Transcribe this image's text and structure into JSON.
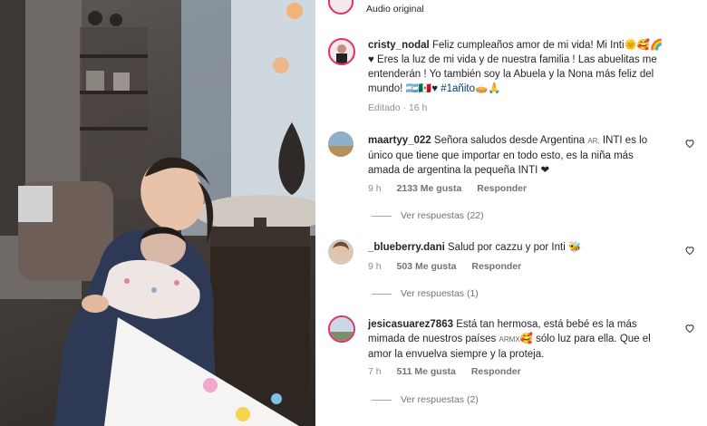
{
  "top": {
    "audio_label": "Audio original"
  },
  "post": {
    "username": "cristy_nodal",
    "caption_lines": [
      "Feliz cumpleaños amor de mi vida! Mi Inti🌞🥰🌈",
      "♥ Eres la luz de mi vida y de nuestra familia ! Las abuelitas me",
      "entenderán ! Yo también soy la Abuela y la Nona más feliz del",
      "mundo! 🇦🇷🇲🇽♥"
    ],
    "hashtag": "#1añito",
    "hashtag_emoji": "🥧🙏",
    "edited": "Editado · 16 h"
  },
  "comments": [
    {
      "username": "maartyy_022",
      "lines": [
        "Señora saludos desde Argentina",
        "INTI es lo",
        "único que tiene que importar en todo esto, es la niña más",
        "amada de argentina la pequeña INTI ❤"
      ],
      "flag_text": "AR,",
      "time": "9 h",
      "likes": "2133 Me gusta",
      "reply": "Responder",
      "replies": "Ver respuestas (22)"
    },
    {
      "username": "_blueberry.dani",
      "lines": [
        "Salud por cazzu y por Inti 🐝"
      ],
      "time": "9 h",
      "likes": "503 Me gusta",
      "reply": "Responder",
      "replies": "Ver respuestas (1)"
    },
    {
      "username": "jesicasuarez7863",
      "lines": [
        "Está tan hermosa, está bebé es la más",
        "mimada de nuestros países",
        "🥰 sólo luz para ella. Que el",
        "amor la envuelva siempre y la proteja."
      ],
      "flag_text": "ARMX",
      "time": "7 h",
      "likes": "511 Me gusta",
      "reply": "Responder",
      "replies": "Ver respuestas (2)"
    }
  ],
  "colors": {
    "heart": "#262626",
    "hashtag": "#00376b",
    "muted": "#8e8e8e"
  }
}
